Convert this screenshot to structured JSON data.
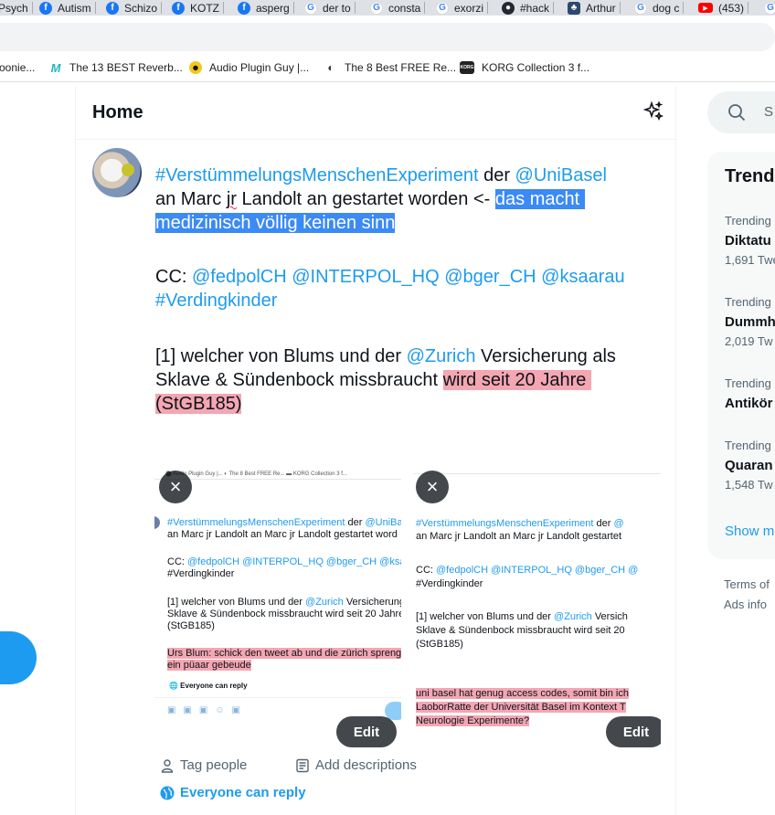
{
  "browser": {
    "tabs": [
      {
        "label": "Psych",
        "icon": "partial-icon"
      },
      {
        "label": "Autism",
        "icon": "facebook-icon"
      },
      {
        "label": "Schizo",
        "icon": "facebook-icon"
      },
      {
        "label": "KOTZ",
        "icon": "facebook-icon"
      },
      {
        "label": "asperg",
        "icon": "facebook-icon"
      },
      {
        "label": "der to",
        "icon": "google-icon"
      },
      {
        "label": "consta",
        "icon": "google-icon"
      },
      {
        "label": "exorzi",
        "icon": "google-icon"
      },
      {
        "label": "#hack",
        "icon": "github-icon"
      },
      {
        "label": "Arthur",
        "icon": "tree-icon"
      },
      {
        "label": "dog c",
        "icon": "google-icon"
      },
      {
        "label": "(453) ",
        "icon": "youtube-icon"
      },
      {
        "label": "G",
        "icon": "google-icon"
      }
    ],
    "bookmarks": [
      {
        "label": "oonie...",
        "icon": ""
      },
      {
        "label": "The 13 BEST Reverb...",
        "icon": "M"
      },
      {
        "label": "Audio Plugin Guy |...",
        "icon": "☻"
      },
      {
        "label": "The 8 Best FREE Re...",
        "icon": "◐"
      },
      {
        "label": "KORG Collection 3 f...",
        "icon": "KORG"
      }
    ]
  },
  "header": {
    "title": "Home"
  },
  "compose": {
    "line1_tag": "#VerstümmelungsMenschenExperiment",
    "line1_der": " der ",
    "line1_mention": "@UniBasel",
    "line2_a": "an Marc ",
    "line2_jr": "jr",
    "line2_b": " Landolt an gestartet worden <- ",
    "line2_sel": "das macht ",
    "line3_sel": "medizinisch völlig keinen sinn",
    "cc_label": "CC: ",
    "cc_mentions": "@fedpolCH @INTERPOL_HQ @bger_CH @ksaarau",
    "cc_tag": "#Verdingkinder",
    "p3_a": "[1] welcher von Blums und der ",
    "p3_mention": "@Zurich",
    "p3_b": " Versicherung als",
    "p3_c": "Sklave & Sündenbock missbraucht ",
    "p3_hl1": "wird seit 20 Jahre ",
    "p3_hl2": "(StGB185)"
  },
  "media": [
    {
      "bookmarks": "⬤ Audio Plugin Guy |...   ◐ The 8 Best FREE Re...   ▬ KORG Collection 3 f...",
      "line1_tag": "#VerstümmelungsMenschenExperiment",
      "line1_der": " der ",
      "line1_mention": "@UniBa",
      "line2": "an Marc jr Landolt an Marc jr Landolt gestartet word",
      "cc": "CC: ",
      "cc_mentions": "@fedpolCH @INTERPOL_HQ @bger_CH @ksaar",
      "cc_tag": "#Verdingkinder",
      "p3_a": "[1] welcher von Blums und der ",
      "p3_mention": "@Zurich",
      "p3_b": " Versicherung",
      "p3_c": "Sklave & Sündenbock missbraucht wird seit 20 Jahre",
      "p3_d": "(StGB185)",
      "hl_1": "Urs Blum: schick den tweet ab und die zürich spreng",
      "hl_2": "ein püaar gebeude",
      "reply": "🌐 Everyone can reply",
      "edit_label": "Edit"
    },
    {
      "line1_tag": "#VerstümmelungsMenschenExperiment",
      "line1_der": " der ",
      "line1_mention": "@",
      "line2": "an Marc jr Landolt an Marc jr Landolt gestartet",
      "cc": "CC: ",
      "cc_mentions": "@fedpolCH @INTERPOL_HQ @bger_CH @",
      "cc_tag": "#Verdingkinder",
      "p3_a": "[1] welcher von Blums und der ",
      "p3_mention": "@Zurich",
      "p3_b": " Versich",
      "p3_c": "Sklave & Sündenbock missbraucht wird seit 20",
      "p3_d": "(StGB185)",
      "hl_1": "uni basel hat genug access codes, somit bin ich",
      "hl_2": "LaoborRatte der Universität Basel im Kontext T",
      "hl_3": "Neurologie Experimente?",
      "edit_label": "Edit"
    }
  ],
  "actions": {
    "tag_people": "Tag people",
    "add_descriptions": "Add descriptions",
    "everyone_can_reply": "Everyone can reply"
  },
  "sidebar": {
    "search_placeholder": "S",
    "trends_title": "Trend",
    "trends": [
      {
        "label": "Trending",
        "name": "Diktatu",
        "count": "1,691 Twe"
      },
      {
        "label": "Trending",
        "name": "Dummh",
        "count": "2,019 Tw"
      },
      {
        "label": "Trending",
        "name": "Antikör",
        "count": ""
      },
      {
        "label": "Trending",
        "name": "Quaran",
        "count": "1,548 Tw"
      }
    ],
    "show_more": "Show m",
    "terms": "Terms of",
    "ads": "Ads info"
  },
  "colors": {
    "accent": "#1d9bf0",
    "selection": "#3b8af5",
    "highlight": "#f4a6b3"
  }
}
